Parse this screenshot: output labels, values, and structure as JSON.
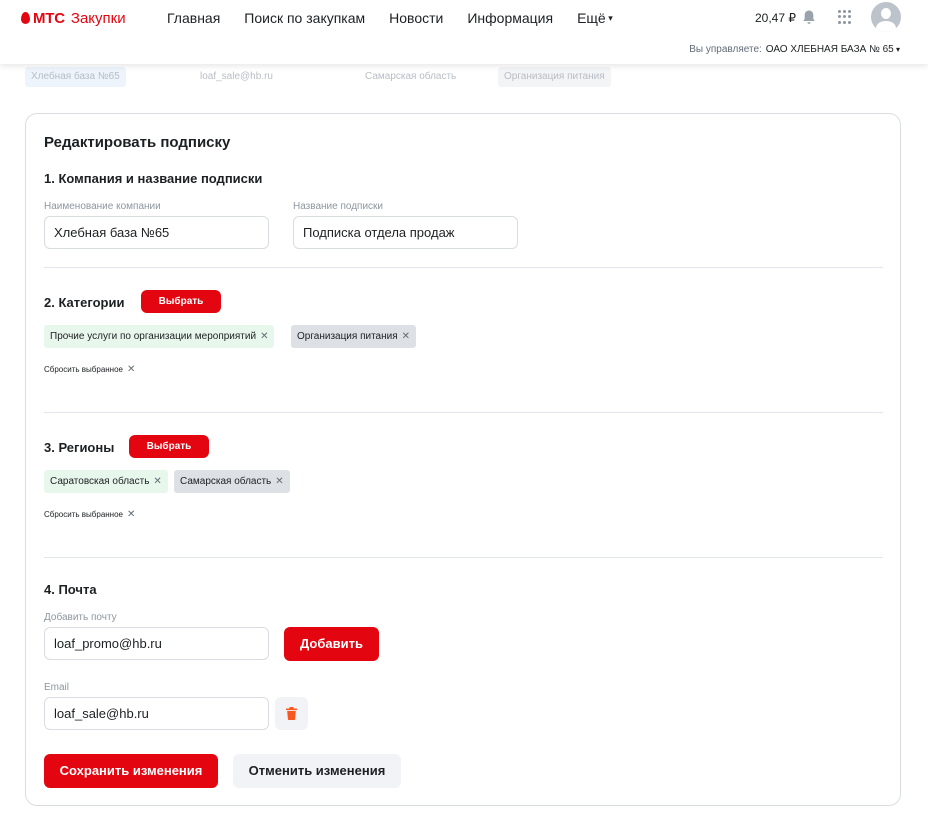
{
  "brand": {
    "logo_text": "МТС",
    "product": "Закупки",
    "accent": "#e30611"
  },
  "nav": {
    "items": [
      {
        "label": "Главная"
      },
      {
        "label": "Поиск по закупкам"
      },
      {
        "label": "Новости"
      },
      {
        "label": "Информация"
      },
      {
        "label": "Ещё"
      }
    ]
  },
  "header": {
    "balance": "20,47 ₽",
    "manage_label": "Вы управляете:",
    "manage_org": "ОАО ХЛЕБНАЯ БАЗА № 65"
  },
  "background_row": {
    "company": "Хлебная база №65",
    "email": "loaf_sale@hb.ru",
    "region": "Самарская область",
    "category": "Организация питания"
  },
  "form": {
    "title": "Редактировать подписку",
    "section1": {
      "heading": "1. Компания и название подписки",
      "company_label": "Наименование компании",
      "company_value": "Хлебная база №65",
      "name_label": "Название подписки",
      "name_value": "Подписка отдела продаж"
    },
    "section2": {
      "heading": "2. Категории",
      "select_button": "Выбрать",
      "chips": [
        "Прочие услуги по организации мероприятий",
        "Организация питания"
      ],
      "reset": "Сбросить выбранное"
    },
    "section3": {
      "heading": "3. Регионы",
      "select_button": "Выбрать",
      "chips": [
        "Саратовская область",
        "Самарская область"
      ],
      "reset": "Сбросить выбранное"
    },
    "section4": {
      "heading": "4. Почта",
      "add_label": "Добавить почту",
      "add_value": "loaf_promo@hb.ru",
      "add_button": "Добавить",
      "email_label": "Email",
      "email_value": "loaf_sale@hb.ru"
    },
    "save_button": "Сохранить изменения",
    "cancel_button": "Отменить изменения"
  },
  "icons": {
    "bell": "bell-icon",
    "apps": "apps-grid-icon",
    "avatar": "user-avatar-icon",
    "trash": "trash-icon",
    "remove": "close-icon"
  },
  "colors": {
    "chip_selected_green": "#e8f7ec",
    "chip_grey": "#dde0e5",
    "trash": "#f95721"
  }
}
